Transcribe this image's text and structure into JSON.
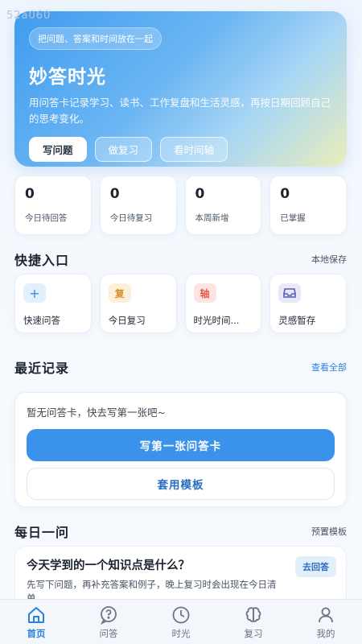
{
  "watermark": "52a060",
  "hero": {
    "tag": "把问题、答案和时间放在一起",
    "title": "妙答时光",
    "description": "用问答卡记录学习、读书、工作复盘和生活灵感，再按日期回顾自己的思考变化。",
    "buttons": [
      "写问题",
      "做复习",
      "看时间轴"
    ]
  },
  "stats": [
    {
      "value": "0",
      "label": "今日待回答"
    },
    {
      "value": "0",
      "label": "今日待复习"
    },
    {
      "value": "0",
      "label": "本周新增"
    },
    {
      "value": "0",
      "label": "已掌握"
    }
  ],
  "quick": {
    "title": "快捷入口",
    "link": "本地保存",
    "items": [
      {
        "icon_char": "+",
        "icon": "plus-icon",
        "label": "快速问答"
      },
      {
        "icon_char": "复",
        "icon": "review-icon",
        "label": "今日复习"
      },
      {
        "icon_char": "轴",
        "icon": "timeline-icon",
        "label": "时光时间..."
      },
      {
        "icon_char": "",
        "icon": "inbox-icon",
        "label": "灵感暂存"
      }
    ]
  },
  "recent": {
    "title": "最近记录",
    "link": "查看全部",
    "empty_text": "暂无问答卡，快去写第一张吧~",
    "primary_button": "写第一张问答卡",
    "secondary_button": "套用模板"
  },
  "daily": {
    "title": "每日一问",
    "link": "预置模板",
    "question": "今天学到的一个知识点是什么？",
    "description": "先写下问题，再补充答案和例子，晚上复习时会出现在今日清单。",
    "answer_button": "去回答"
  },
  "tabbar": {
    "active": "home",
    "items": [
      {
        "key": "home",
        "label": "首页"
      },
      {
        "key": "qa",
        "label": "问答"
      },
      {
        "key": "time",
        "label": "时光"
      },
      {
        "key": "review",
        "label": "复习"
      },
      {
        "key": "me",
        "label": "我的"
      }
    ]
  },
  "colors": {
    "accent": "#3b92ea",
    "background": "#eef5fd"
  }
}
